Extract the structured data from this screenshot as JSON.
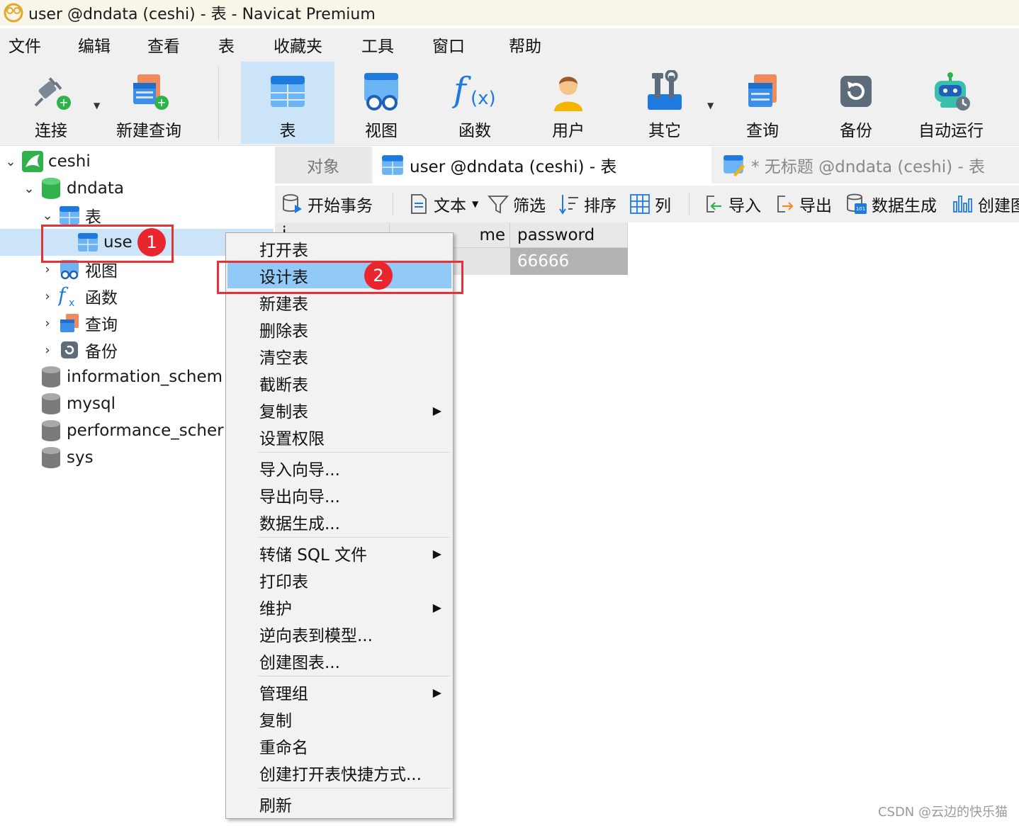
{
  "window": {
    "title": "user @dndata (ceshi) - 表 - Navicat Premium"
  },
  "menubar": [
    "文件",
    "编辑",
    "查看",
    "表",
    "收藏夹",
    "工具",
    "窗口",
    "帮助"
  ],
  "toolbar": {
    "connect": "连接",
    "new_query": "新建查询",
    "table": "表",
    "view": "视图",
    "function": "函数",
    "user": "用户",
    "other": "其它",
    "query": "查询",
    "backup": "备份",
    "automation": "自动运行"
  },
  "tree": {
    "connection": "ceshi",
    "database": "dndata",
    "tables_folder": "表",
    "table_user": "use",
    "views": "视图",
    "functions": "函数",
    "queries": "查询",
    "backups": "备份",
    "other_dbs": [
      "information_schem",
      "mysql",
      "performance_scher",
      "sys"
    ]
  },
  "tabs": {
    "objects": "对象",
    "current": "user @dndata (ceshi) - 表",
    "other": "* 无标题 @dndata (ceshi) - 表"
  },
  "subtoolbar": {
    "begin_tx": "开始事务",
    "text": "文本",
    "filter": "筛选",
    "sort": "排序",
    "columns": "列",
    "import": "导入",
    "export": "导出",
    "data_gen": "数据生成",
    "create_chart": "创建图"
  },
  "grid": {
    "col_id_partial": "i",
    "col_name_partial": "me",
    "col_password": "password",
    "password_value": "66666"
  },
  "context_menu": {
    "items": [
      "打开表",
      "设计表",
      "新建表",
      "删除表",
      "清空表",
      "截断表",
      "复制表",
      "设置权限",
      "导入向导...",
      "导出向导...",
      "数据生成...",
      "转储 SQL 文件",
      "打印表",
      "维护",
      "逆向表到模型...",
      "创建图表...",
      "管理组",
      "复制",
      "重命名",
      "创建打开表快捷方式...",
      "刷新"
    ],
    "highlighted": "设计表"
  },
  "annotations": {
    "badge1": "1",
    "badge2": "2"
  },
  "watermark": "CSDN @云边的快乐猫",
  "colors": {
    "accent": "#cce4f7",
    "menu_highlight": "#91c9f7",
    "annotation_red": "#e2323a"
  }
}
